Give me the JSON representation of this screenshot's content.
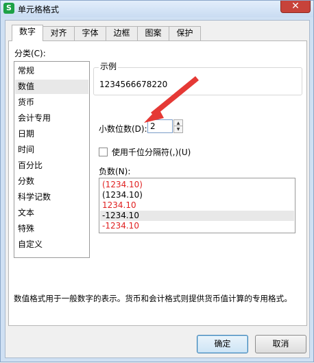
{
  "window": {
    "title": "单元格格式",
    "app_icon": "S",
    "close_glyph": "✕"
  },
  "tabs": [
    {
      "label": "数字",
      "active": true
    },
    {
      "label": "对齐"
    },
    {
      "label": "字体"
    },
    {
      "label": "边框"
    },
    {
      "label": "图案"
    },
    {
      "label": "保护"
    }
  ],
  "category": {
    "label": "分类(C):",
    "items": [
      "常规",
      "数值",
      "货币",
      "会计专用",
      "日期",
      "时间",
      "百分比",
      "分数",
      "科学记数",
      "文本",
      "特殊",
      "自定义"
    ],
    "selected": "数值"
  },
  "sample": {
    "title": "示例",
    "value": "1234566678220"
  },
  "decimal_places": {
    "label": "小数位数(D):",
    "value": "2"
  },
  "thousands_separator": {
    "label": "使用千位分隔符(,)(U)",
    "checked": false
  },
  "negative_numbers": {
    "label": "负数(N):",
    "items": [
      {
        "text": "(1234.10)",
        "color": "#e02020"
      },
      {
        "text": "(1234.10)",
        "color": "#000000"
      },
      {
        "text": "1234.10",
        "color": "#e02020"
      },
      {
        "text": "-1234.10",
        "color": "#000000",
        "selected": true
      },
      {
        "text": "-1234.10",
        "color": "#e02020"
      }
    ]
  },
  "description": "数值格式用于一般数字的表示。货币和会计格式则提供货币值计算的专用格式。",
  "buttons": {
    "ok": "确定",
    "cancel": "取消"
  },
  "colors": {
    "annotation_arrow": "#e53935",
    "negative_red": "#e02020",
    "ok_border": "#3c7fb1"
  }
}
